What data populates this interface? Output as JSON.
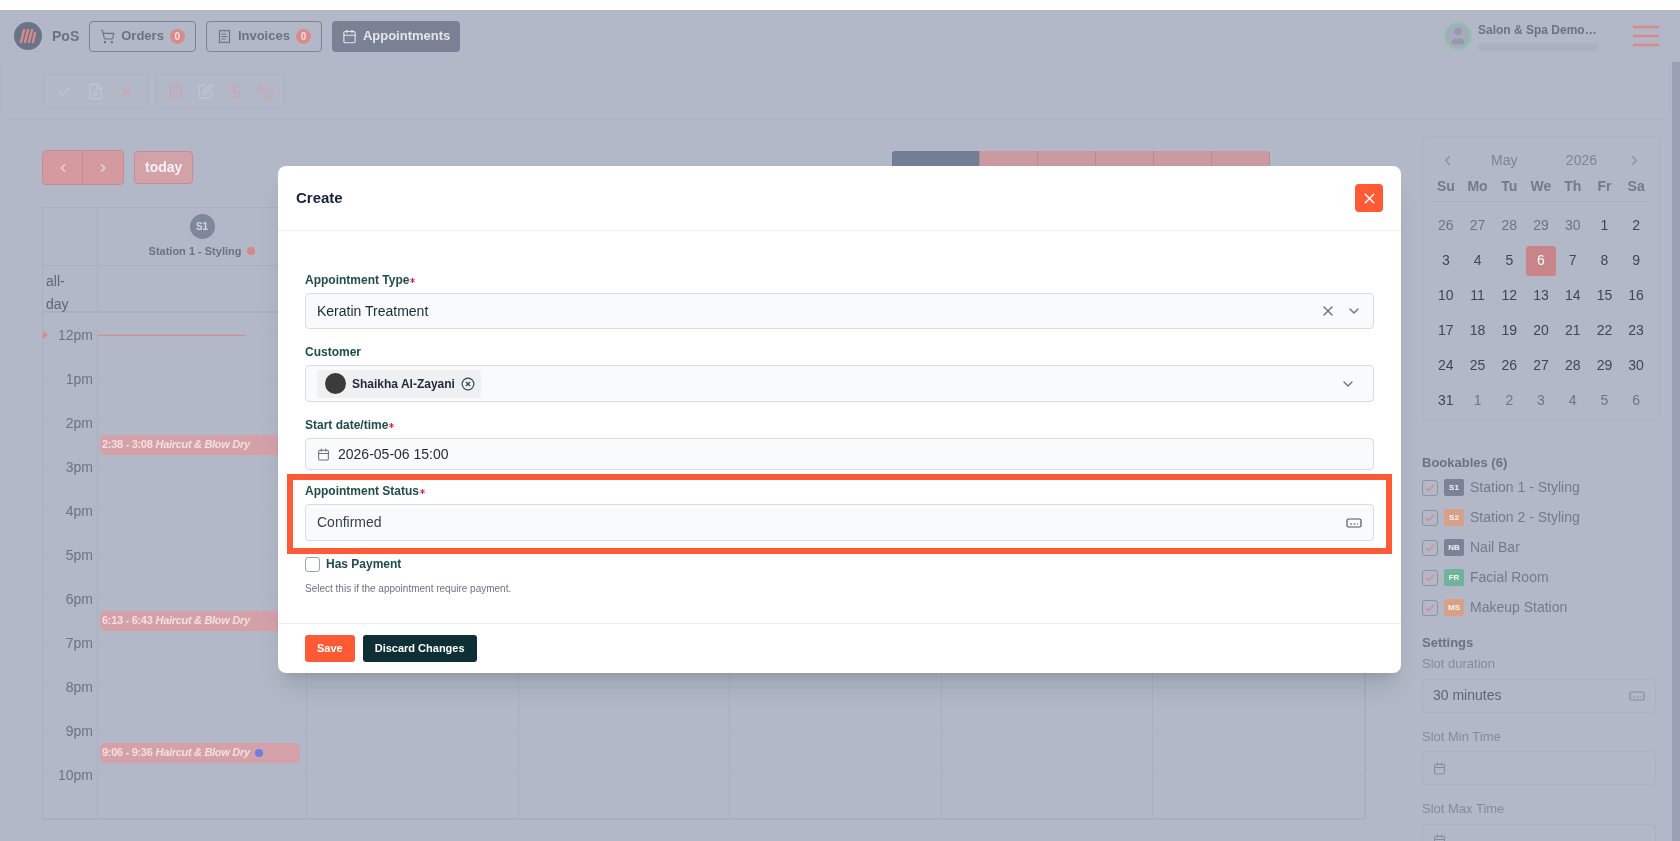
{
  "topbar": {
    "app_label": "PoS",
    "nav": [
      {
        "kind": "cart",
        "label": "Orders",
        "badge": "0",
        "selected": false
      },
      {
        "kind": "receipt",
        "label": "Invoices",
        "badge": "0",
        "selected": false
      },
      {
        "kind": "calendar",
        "label": "Appointments",
        "selected": true
      }
    ],
    "user": {
      "name": "Salon & Spa Demo…"
    }
  },
  "calendar": {
    "today": "today",
    "view_tabs": [
      {
        "selected": true
      },
      {
        "selected": false
      },
      {
        "selected": false
      },
      {
        "selected": false
      },
      {
        "selected": false
      },
      {
        "selected": false
      }
    ],
    "resource": {
      "avatar": "S1",
      "name": "Station 1 - Styling",
      "color": "#d9868a"
    },
    "allday": "all-day",
    "hours": [
      {
        "label": "12pm",
        "now": true
      },
      {
        "label": "1pm"
      },
      {
        "label": "2pm",
        "events": [
          {
            "time": "2:38 - 3:08",
            "title": "Haircut & Blow Dry"
          }
        ]
      },
      {
        "label": "3pm"
      },
      {
        "label": "4pm"
      },
      {
        "label": "5pm"
      },
      {
        "label": "6pm",
        "events": [
          {
            "time": "6:13 - 6:43",
            "title": "Haircut & Blow Dry"
          }
        ]
      },
      {
        "label": "7pm"
      },
      {
        "label": "8pm"
      },
      {
        "label": "9pm",
        "events": [
          {
            "time": "9:06 - 9:36",
            "title": "Haircut & Blow Dry",
            "color": "#6b7fe0"
          }
        ]
      },
      {
        "label": "10pm"
      }
    ]
  },
  "sidebar": {
    "mini_calendar": {
      "month": "May",
      "year": "2026",
      "weekdays": [
        "Su",
        "Mo",
        "Tu",
        "We",
        "Th",
        "Fr",
        "Sa"
      ],
      "days": [
        {
          "label": "26",
          "muted": true,
          "selected": false
        },
        {
          "label": "27",
          "muted": true,
          "selected": false
        },
        {
          "label": "28",
          "muted": true,
          "selected": false
        },
        {
          "label": "29",
          "muted": true,
          "selected": false
        },
        {
          "label": "30",
          "muted": true,
          "selected": false
        },
        {
          "label": "1",
          "muted": false,
          "selected": false
        },
        {
          "label": "2",
          "muted": false,
          "selected": false
        },
        {
          "label": "3",
          "muted": false,
          "selected": false
        },
        {
          "label": "4",
          "muted": false,
          "selected": false
        },
        {
          "label": "5",
          "muted": false,
          "selected": false
        },
        {
          "label": "6",
          "muted": false,
          "selected": true
        },
        {
          "label": "7",
          "muted": false,
          "selected": false
        },
        {
          "label": "8",
          "muted": false,
          "selected": false
        },
        {
          "label": "9",
          "muted": false,
          "selected": false
        },
        {
          "label": "10",
          "muted": false,
          "selected": false
        },
        {
          "label": "11",
          "muted": false,
          "selected": false
        },
        {
          "label": "12",
          "muted": false,
          "selected": false
        },
        {
          "label": "13",
          "muted": false,
          "selected": false
        },
        {
          "label": "14",
          "muted": false,
          "selected": false
        },
        {
          "label": "15",
          "muted": false,
          "selected": false
        },
        {
          "label": "16",
          "muted": false,
          "selected": false
        },
        {
          "label": "17",
          "muted": false,
          "selected": false
        },
        {
          "label": "18",
          "muted": false,
          "selected": false
        },
        {
          "label": "19",
          "muted": false,
          "selected": false
        },
        {
          "label": "20",
          "muted": false,
          "selected": false
        },
        {
          "label": "21",
          "muted": false,
          "selected": false
        },
        {
          "label": "22",
          "muted": false,
          "selected": false
        },
        {
          "label": "23",
          "muted": false,
          "selected": false
        },
        {
          "label": "24",
          "muted": false,
          "selected": false
        },
        {
          "label": "25",
          "muted": false,
          "selected": false
        },
        {
          "label": "26",
          "muted": false,
          "selected": false
        },
        {
          "label": "27",
          "muted": false,
          "selected": false
        },
        {
          "label": "28",
          "muted": false,
          "selected": false
        },
        {
          "label": "29",
          "muted": false,
          "selected": false
        },
        {
          "label": "30",
          "muted": false,
          "selected": false
        },
        {
          "label": "31",
          "muted": false,
          "selected": false
        },
        {
          "label": "1",
          "muted": true,
          "selected": false
        },
        {
          "label": "2",
          "muted": true,
          "selected": false
        },
        {
          "label": "3",
          "muted": true,
          "selected": false
        },
        {
          "label": "4",
          "muted": true,
          "selected": false
        },
        {
          "label": "5",
          "muted": true,
          "selected": false
        },
        {
          "label": "6",
          "muted": true,
          "selected": false
        }
      ]
    },
    "bookables": {
      "title": "Bookables (6)",
      "items": [
        {
          "abbr": "S1",
          "label": "Station 1 - Styling",
          "color": "#7b8296",
          "checked": true
        },
        {
          "abbr": "S2",
          "label": "Station 2 - Styling",
          "color": "#d6a186",
          "checked": true
        },
        {
          "abbr": "NB",
          "label": "Nail Bar",
          "color": "#7b8296",
          "checked": true
        },
        {
          "abbr": "FR",
          "label": "Facial Room",
          "color": "#6fb39a",
          "checked": true
        },
        {
          "abbr": "MS",
          "label": "Makeup Station",
          "color": "#d6a186",
          "checked": true
        }
      ]
    },
    "settings": {
      "title": "Settings",
      "fields": [
        {
          "kind": "select",
          "label": "Slot duration",
          "value": "30 minutes"
        },
        {
          "kind": "time",
          "label": "Slot Min Time"
        },
        {
          "kind": "time",
          "label": "Slot Max Time"
        }
      ]
    }
  },
  "modal": {
    "title": "Create",
    "fields": [
      {
        "kind": "select",
        "label": "Appointment Type",
        "required": true,
        "value": "Keratin Treatment",
        "clearable": true
      },
      {
        "kind": "multi",
        "label": "Customer",
        "chips": [
          {
            "label": "Shaikha Al-Zayani"
          }
        ]
      },
      {
        "kind": "datetime",
        "label": "Start date/time",
        "required": true,
        "value": "2026-05-06 15:00"
      },
      {
        "kind": "status",
        "label": "Appointment Status",
        "required": true,
        "value": "Confirmed",
        "highlighted": true
      }
    ],
    "checkbox": {
      "label": "Has Payment",
      "checked": false,
      "help": "Select this if the appointment require payment."
    },
    "buttons": [
      {
        "kind": "primary",
        "label": "Save"
      },
      {
        "kind": "dark",
        "label": "Discard Changes"
      }
    ]
  }
}
